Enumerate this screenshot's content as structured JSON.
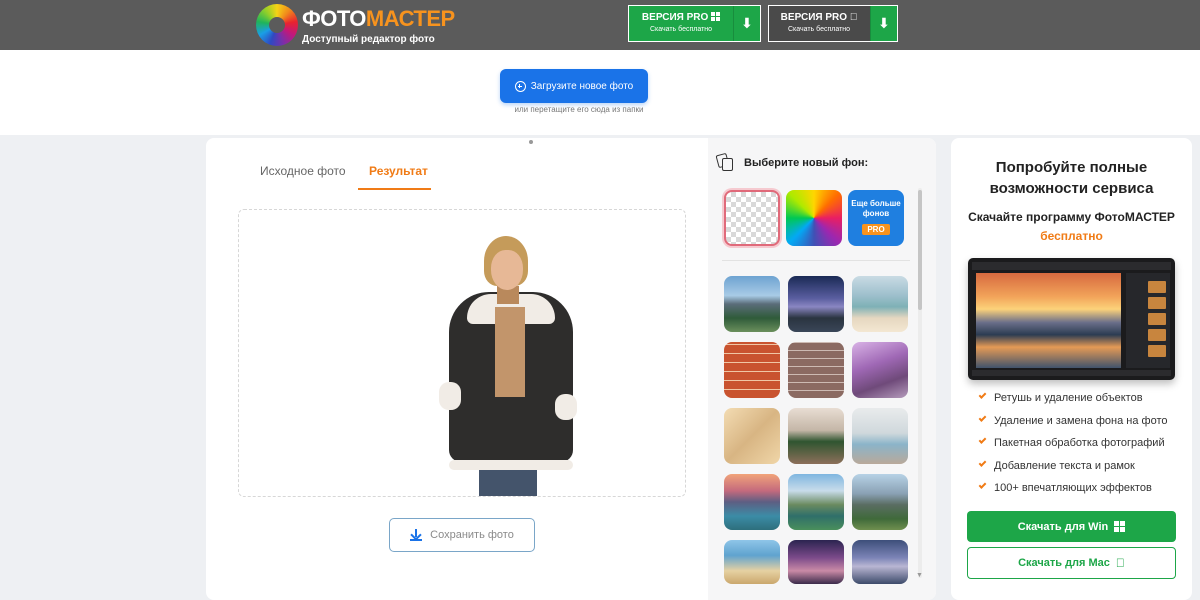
{
  "header": {
    "logo_first": "ФОТО",
    "logo_second": "МАСТЕР",
    "logo_subtitle": "Доступный редактор фото",
    "pro_win": {
      "label": "ВЕРСИЯ PRO",
      "small": "Скачать бесплатно"
    },
    "pro_mac": {
      "label": "ВЕРСИЯ PRO",
      "small": "Скачать бесплатно"
    }
  },
  "upload": {
    "button_label": "Загрузите новое фото",
    "hint": "или перетащите его сюда из папки"
  },
  "editor": {
    "tabs": [
      {
        "label": "Исходное фото",
        "active": false
      },
      {
        "label": "Результат",
        "active": true
      }
    ],
    "save_label": "Сохранить фото"
  },
  "backgrounds": {
    "title": "Выберите новый фон:",
    "more_label": "Еще больше фонов",
    "pro_badge": "PRO",
    "selected": "transparent",
    "thumbnails": [
      "mountain-lake",
      "night-sky",
      "beach",
      "red-brick",
      "grey-brick",
      "purple-garden",
      "fur",
      "christmas-room",
      "interior",
      "sunset-lake",
      "valley",
      "mountain-peaks",
      "tropical-coast",
      "night-street",
      "dusk-sea"
    ]
  },
  "promo": {
    "title": "Попробуйте полные возможности сервиса",
    "subtitle": "Скачайте программу ФотоМАСТЕР",
    "free": "бесплатно",
    "features": [
      "Ретушь и удаление объектов",
      "Удаление и замена фона на фото",
      "Пакетная обработка фотографий",
      "Добавление текста и рамок",
      "100+ впечатляющих эффектов"
    ],
    "download_win": "Скачать для Win",
    "download_mac": "Скачать для Mac"
  },
  "colors": {
    "header_bg": "#5b5b5b",
    "brand_orange": "#f07b16",
    "primary_blue": "#1a73e8",
    "green": "#1da648"
  }
}
